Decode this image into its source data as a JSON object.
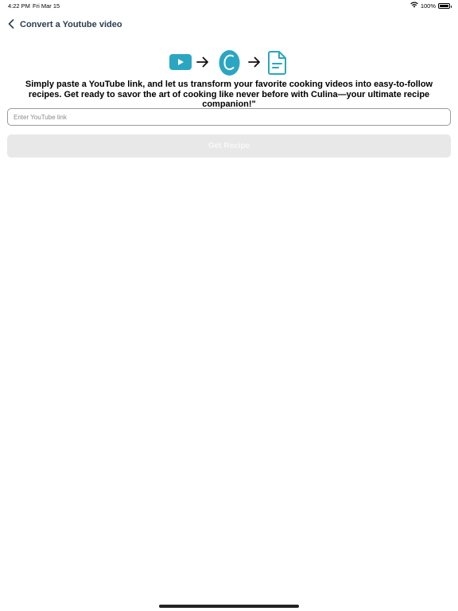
{
  "status": {
    "time": "4:22 PM",
    "date": "Fri Mar 15",
    "battery": "100%",
    "wifi_icon": "wifi-icon",
    "battery_icon": "battery-icon"
  },
  "nav": {
    "back_icon": "chevron-left-icon",
    "title": "Convert a Youtube video"
  },
  "hero": {
    "icons": [
      "youtube-play-icon",
      "arrow-right-icon",
      "culina-logo-icon",
      "arrow-right-icon",
      "document-icon"
    ],
    "accent_color": "#2ba6c2",
    "logo_letter": "C"
  },
  "description": "Simply paste a YouTube link, and let us transform your favorite cooking videos into easy-to-follow recipes. Get ready to savor the art of cooking like never before with Culina—your ultimate recipe companion!\"",
  "input": {
    "value": "",
    "placeholder": "Enter YouTube link"
  },
  "button": {
    "label": "Get Recipe",
    "state": "disabled"
  }
}
